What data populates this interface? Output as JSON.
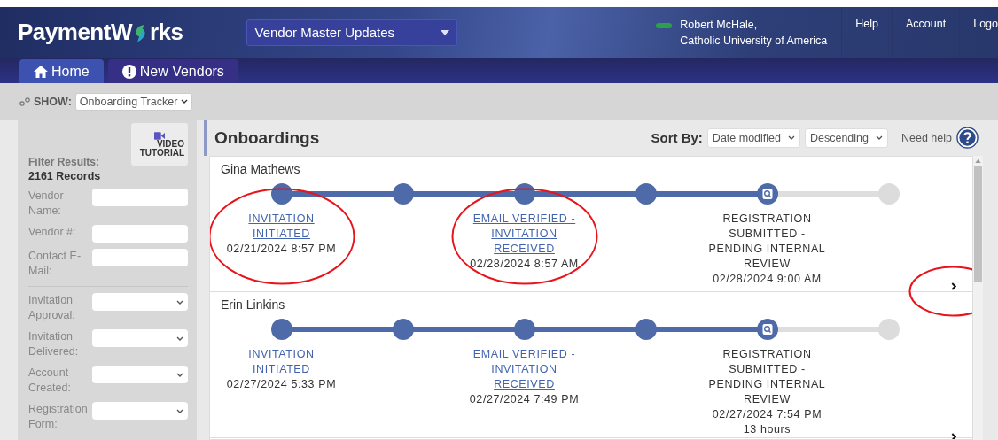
{
  "header": {
    "logo_start": "PaymentW",
    "logo_end": "rks",
    "workspace": "Vendor Master Updates",
    "user_name": "Robert McHale,",
    "organization": "Catholic University of America",
    "links": [
      "Help",
      "Account",
      "Logo"
    ]
  },
  "nav": {
    "tabs": [
      {
        "label": "Home",
        "kind": "home",
        "selected": true
      },
      {
        "label": "New Vendors",
        "kind": "alert",
        "selected": false
      }
    ]
  },
  "show": {
    "label": "SHOW:",
    "value": "Onboarding Tracker"
  },
  "sidebar": {
    "video_button": "VIDEO TUTORIAL",
    "filter_title": "Filter Results:",
    "record_count": "2161 Records",
    "filters": [
      {
        "label": "Vendor Name:",
        "kind": "text"
      },
      {
        "label": "Vendor #:",
        "kind": "text"
      },
      {
        "label": "Contact E-Mail:",
        "kind": "text"
      },
      {
        "label": "Invitation Approval:",
        "kind": "select",
        "divider_before": true
      },
      {
        "label": "Invitation Delivered:",
        "kind": "select"
      },
      {
        "label": "Account Created:",
        "kind": "select"
      },
      {
        "label": "Registration Form:",
        "kind": "select"
      }
    ]
  },
  "main": {
    "title": "Onboardings",
    "sort_label": "Sort By:",
    "sort_field": "Date modified",
    "sort_order": "Descending",
    "help_label": "Need help",
    "onboardings": [
      {
        "name": "Gina Mathews",
        "next_circled": true,
        "steps": [
          {
            "kind": "done",
            "label": "INVITATION INITIATED",
            "date": "02/21/2024 8:57 PM",
            "circled": true
          },
          {
            "kind": "done"
          },
          {
            "kind": "done",
            "label": "EMAIL VERIFIED - INVITATION RECEIVED",
            "date": "02/28/2024 8:57 AM",
            "circled": true
          },
          {
            "kind": "done"
          },
          {
            "kind": "current",
            "label": "REGISTRATION SUBMITTED - PENDING INTERNAL REVIEW",
            "date": "02/28/2024 9:00 AM"
          },
          {
            "kind": "pending"
          }
        ]
      },
      {
        "name": "Erin Linkins",
        "next_circled": false,
        "steps": [
          {
            "kind": "done",
            "label": "INVITATION INITIATED",
            "date": "02/27/2024 5:33 PM",
            "circled": false
          },
          {
            "kind": "done"
          },
          {
            "kind": "done",
            "label": "EMAIL VERIFIED - INVITATION RECEIVED",
            "date": "02/27/2024 7:49 PM",
            "circled": false
          },
          {
            "kind": "done"
          },
          {
            "kind": "current",
            "label": "REGISTRATION SUBMITTED - PENDING INTERNAL REVIEW",
            "date": "02/27/2024 7:54 PM",
            "duration": "13 hours"
          },
          {
            "kind": "pending"
          }
        ]
      }
    ]
  }
}
